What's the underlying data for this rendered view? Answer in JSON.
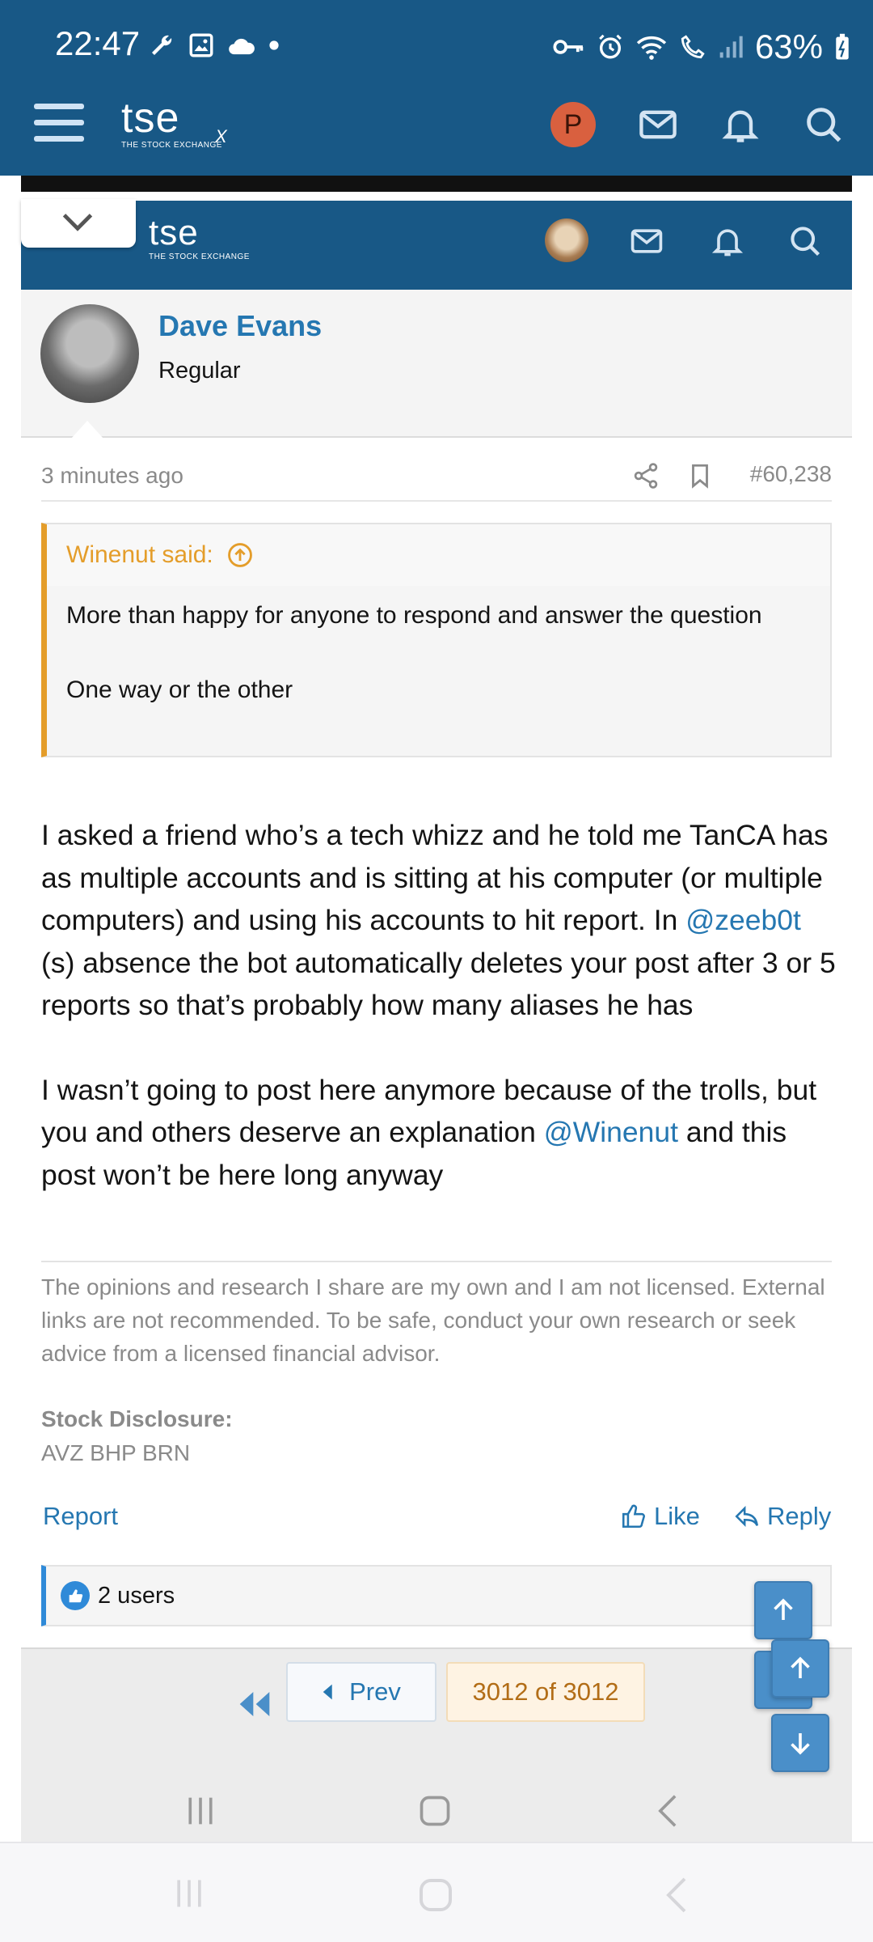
{
  "status_bar": {
    "time": "22:47",
    "battery": "63%"
  },
  "app_header": {
    "logo_text": "tse",
    "logo_subtext": "THE STOCK EXCHANGE",
    "logo_mark": "X",
    "avatar_letter": "P",
    "icons": [
      "menu-icon",
      "mail-icon",
      "bell-icon",
      "search-icon"
    ],
    "brand_color": "#185886"
  },
  "post": {
    "author": "Dave Evans",
    "author_title": "Regular",
    "time_ago": "3 minutes ago",
    "post_number": "#60,238",
    "quote": {
      "author_line": "Winenut said:",
      "lines": [
        "More than happy for anyone to respond and answer the question",
        "One way or the other"
      ]
    },
    "body": {
      "p1_before": "I asked a friend who’s a tech whizz and he told me TanCA has as multiple accounts and is sitting at his computer (or multiple computers) and using his accounts to hit report. In ",
      "p1_mention": "@zeeb0t",
      "p1_after": " (s) absence the bot automatically deletes your post after 3 or 5 reports so that’s probably how many aliases he has",
      "p2_before": "I wasn’t going to post here anymore because of the trolls, but you and others deserve an explanation ",
      "p2_mention": "@Winenut",
      "p2_after": " and this post won’t be here long anyway"
    },
    "signature": "The opinions and research I share are my own and I am not licensed. External links are not recommended. To be safe, conduct your own research or seek advice from a licensed financial advisor.",
    "disclosure_title": "Stock Disclosure:",
    "disclosure_value": "AVZ BHP BRN",
    "actions": {
      "report": "Report",
      "like": "Like",
      "reply": "Reply"
    },
    "reactions": "2 users"
  },
  "pagination": {
    "prev_label": "Prev",
    "page_label": "3012 of 3012"
  },
  "colors": {
    "link": "#2577b1",
    "quote_accent": "#e49d2a",
    "float_button": "#4a8fc9"
  }
}
